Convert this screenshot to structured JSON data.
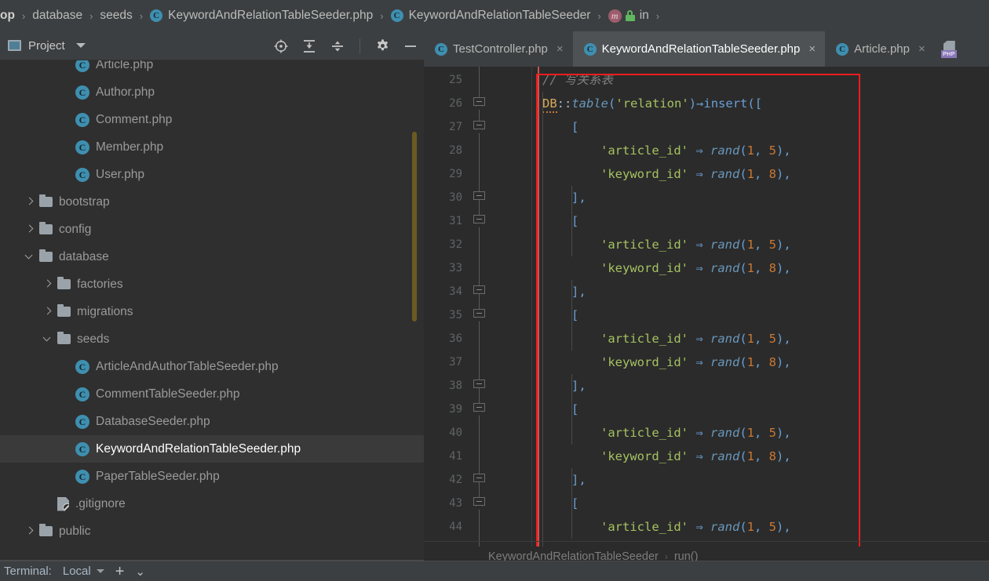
{
  "navbar": {
    "items": [
      {
        "label": "op",
        "icon": null,
        "bold": true
      },
      {
        "label": "database",
        "icon": null,
        "bold": false
      },
      {
        "label": "seeds",
        "icon": null,
        "bold": false
      },
      {
        "label": "KeywordAndRelationTableSeeder.php",
        "icon": "class-icon",
        "bold": false
      },
      {
        "label": "KeywordAndRelationTableSeeder",
        "icon": "class-icon",
        "bold": false
      },
      {
        "label": "in",
        "icon": "method-icon",
        "bold": false
      }
    ],
    "separator": "›"
  },
  "sidebar": {
    "title": "Project",
    "tools": [
      {
        "name": "locate-icon"
      },
      {
        "name": "expand-all-icon"
      },
      {
        "name": "collapse-all-icon"
      },
      {
        "name": "gear-icon"
      },
      {
        "name": "minimize-icon"
      }
    ],
    "tree": [
      {
        "label": "Article.php",
        "type": "file",
        "indent": 3,
        "expanded": null,
        "selected": false
      },
      {
        "label": "Author.php",
        "type": "file",
        "indent": 3,
        "expanded": null,
        "selected": false
      },
      {
        "label": "Comment.php",
        "type": "file",
        "indent": 3,
        "expanded": null,
        "selected": false
      },
      {
        "label": "Member.php",
        "type": "file",
        "indent": 3,
        "expanded": null,
        "selected": false
      },
      {
        "label": "User.php",
        "type": "file",
        "indent": 3,
        "expanded": null,
        "selected": false
      },
      {
        "label": "bootstrap",
        "type": "folder",
        "indent": 1,
        "expanded": false,
        "selected": false
      },
      {
        "label": "config",
        "type": "folder",
        "indent": 1,
        "expanded": false,
        "selected": false
      },
      {
        "label": "database",
        "type": "folder",
        "indent": 1,
        "expanded": true,
        "selected": false
      },
      {
        "label": "factories",
        "type": "folder",
        "indent": 2,
        "expanded": false,
        "selected": false
      },
      {
        "label": "migrations",
        "type": "folder",
        "indent": 2,
        "expanded": false,
        "selected": false
      },
      {
        "label": "seeds",
        "type": "folder",
        "indent": 2,
        "expanded": true,
        "selected": false
      },
      {
        "label": "ArticleAndAuthorTableSeeder.php",
        "type": "file",
        "indent": 3,
        "expanded": null,
        "selected": false
      },
      {
        "label": "CommentTableSeeder.php",
        "type": "file",
        "indent": 3,
        "expanded": null,
        "selected": false
      },
      {
        "label": "DatabaseSeeder.php",
        "type": "file",
        "indent": 3,
        "expanded": null,
        "selected": false
      },
      {
        "label": "KeywordAndRelationTableSeeder.php",
        "type": "file",
        "indent": 3,
        "expanded": null,
        "selected": true
      },
      {
        "label": "PaperTableSeeder.php",
        "type": "file",
        "indent": 3,
        "expanded": null,
        "selected": false
      },
      {
        "label": ".gitignore",
        "type": "gitignore",
        "indent": 2,
        "expanded": null,
        "selected": false
      },
      {
        "label": "public",
        "type": "folder",
        "indent": 1,
        "expanded": false,
        "selected": false
      }
    ]
  },
  "editor": {
    "tabs": [
      {
        "label": "TestController.php",
        "icon": "class-icon",
        "active": false,
        "close": "×"
      },
      {
        "label": "KeywordAndRelationTableSeeder.php",
        "icon": "class-icon",
        "active": true,
        "close": "×"
      },
      {
        "label": "Article.php",
        "icon": "class-icon",
        "active": false,
        "close": "×"
      }
    ],
    "extra_tab_icon": "php-file-icon",
    "line_numbers": [
      25,
      26,
      27,
      28,
      29,
      30,
      31,
      32,
      33,
      34,
      35,
      36,
      37,
      38,
      39,
      40,
      41,
      42,
      43,
      44
    ],
    "lines": [
      {
        "n": 25,
        "indent": 0,
        "tokens": [
          {
            "t": "// 写关系表",
            "c": "tk-cmt"
          }
        ]
      },
      {
        "n": 26,
        "indent": 0,
        "tokens": [
          {
            "t": "DB",
            "c": "tk-cls squiggle"
          },
          {
            "t": "::",
            "c": "tk-op"
          },
          {
            "t": "table",
            "c": "tk-fn"
          },
          {
            "t": "(",
            "c": "tk-brk"
          },
          {
            "t": "'relation'",
            "c": "tk-str"
          },
          {
            "t": ")",
            "c": "tk-brk"
          },
          {
            "t": "→",
            "c": "tk-brk"
          },
          {
            "t": "insert",
            "c": "tk-fn2"
          },
          {
            "t": "([",
            "c": "tk-brk"
          }
        ]
      },
      {
        "n": 27,
        "indent": 1,
        "tokens": [
          {
            "t": "[",
            "c": "tk-brk"
          }
        ]
      },
      {
        "n": 28,
        "indent": 2,
        "tokens": [
          {
            "t": "'article_id'",
            "c": "tk-str"
          },
          {
            "t": " ⇒ ",
            "c": "tk-brk"
          },
          {
            "t": "rand",
            "c": "tk-fn"
          },
          {
            "t": "(",
            "c": "tk-brk"
          },
          {
            "t": "1",
            "c": "tk-num"
          },
          {
            "t": ", ",
            "c": "tk-brk"
          },
          {
            "t": "5",
            "c": "tk-num"
          },
          {
            "t": "),",
            "c": "tk-brk"
          }
        ]
      },
      {
        "n": 29,
        "indent": 2,
        "tokens": [
          {
            "t": "'keyword_id'",
            "c": "tk-str"
          },
          {
            "t": " ⇒ ",
            "c": "tk-brk"
          },
          {
            "t": "rand",
            "c": "tk-fn"
          },
          {
            "t": "(",
            "c": "tk-brk"
          },
          {
            "t": "1",
            "c": "tk-num"
          },
          {
            "t": ", ",
            "c": "tk-brk"
          },
          {
            "t": "8",
            "c": "tk-num"
          },
          {
            "t": "),",
            "c": "tk-brk"
          }
        ]
      },
      {
        "n": 30,
        "indent": 1,
        "tokens": [
          {
            "t": "],",
            "c": "tk-brk"
          }
        ]
      },
      {
        "n": 31,
        "indent": 1,
        "tokens": [
          {
            "t": "[",
            "c": "tk-brk"
          }
        ]
      },
      {
        "n": 32,
        "indent": 2,
        "tokens": [
          {
            "t": "'article_id'",
            "c": "tk-str"
          },
          {
            "t": " ⇒ ",
            "c": "tk-brk"
          },
          {
            "t": "rand",
            "c": "tk-fn"
          },
          {
            "t": "(",
            "c": "tk-brk"
          },
          {
            "t": "1",
            "c": "tk-num"
          },
          {
            "t": ", ",
            "c": "tk-brk"
          },
          {
            "t": "5",
            "c": "tk-num"
          },
          {
            "t": "),",
            "c": "tk-brk"
          }
        ]
      },
      {
        "n": 33,
        "indent": 2,
        "tokens": [
          {
            "t": "'keyword_id'",
            "c": "tk-str"
          },
          {
            "t": " ⇒ ",
            "c": "tk-brk"
          },
          {
            "t": "rand",
            "c": "tk-fn"
          },
          {
            "t": "(",
            "c": "tk-brk"
          },
          {
            "t": "1",
            "c": "tk-num"
          },
          {
            "t": ", ",
            "c": "tk-brk"
          },
          {
            "t": "8",
            "c": "tk-num"
          },
          {
            "t": "),",
            "c": "tk-brk"
          }
        ]
      },
      {
        "n": 34,
        "indent": 1,
        "tokens": [
          {
            "t": "],",
            "c": "tk-brk"
          }
        ]
      },
      {
        "n": 35,
        "indent": 1,
        "tokens": [
          {
            "t": "[",
            "c": "tk-brk"
          }
        ]
      },
      {
        "n": 36,
        "indent": 2,
        "tokens": [
          {
            "t": "'article_id'",
            "c": "tk-str"
          },
          {
            "t": " ⇒ ",
            "c": "tk-brk"
          },
          {
            "t": "rand",
            "c": "tk-fn"
          },
          {
            "t": "(",
            "c": "tk-brk"
          },
          {
            "t": "1",
            "c": "tk-num"
          },
          {
            "t": ", ",
            "c": "tk-brk"
          },
          {
            "t": "5",
            "c": "tk-num"
          },
          {
            "t": "),",
            "c": "tk-brk"
          }
        ]
      },
      {
        "n": 37,
        "indent": 2,
        "tokens": [
          {
            "t": "'keyword_id'",
            "c": "tk-str"
          },
          {
            "t": " ⇒ ",
            "c": "tk-brk"
          },
          {
            "t": "rand",
            "c": "tk-fn"
          },
          {
            "t": "(",
            "c": "tk-brk"
          },
          {
            "t": "1",
            "c": "tk-num"
          },
          {
            "t": ", ",
            "c": "tk-brk"
          },
          {
            "t": "8",
            "c": "tk-num"
          },
          {
            "t": "),",
            "c": "tk-brk"
          }
        ]
      },
      {
        "n": 38,
        "indent": 1,
        "tokens": [
          {
            "t": "],",
            "c": "tk-brk"
          }
        ]
      },
      {
        "n": 39,
        "indent": 1,
        "tokens": [
          {
            "t": "[",
            "c": "tk-brk"
          }
        ]
      },
      {
        "n": 40,
        "indent": 2,
        "tokens": [
          {
            "t": "'article_id'",
            "c": "tk-str"
          },
          {
            "t": " ⇒ ",
            "c": "tk-brk"
          },
          {
            "t": "rand",
            "c": "tk-fn"
          },
          {
            "t": "(",
            "c": "tk-brk"
          },
          {
            "t": "1",
            "c": "tk-num"
          },
          {
            "t": ", ",
            "c": "tk-brk"
          },
          {
            "t": "5",
            "c": "tk-num"
          },
          {
            "t": "),",
            "c": "tk-brk"
          }
        ]
      },
      {
        "n": 41,
        "indent": 2,
        "tokens": [
          {
            "t": "'keyword_id'",
            "c": "tk-str"
          },
          {
            "t": " ⇒ ",
            "c": "tk-brk"
          },
          {
            "t": "rand",
            "c": "tk-fn"
          },
          {
            "t": "(",
            "c": "tk-brk"
          },
          {
            "t": "1",
            "c": "tk-num"
          },
          {
            "t": ", ",
            "c": "tk-brk"
          },
          {
            "t": "8",
            "c": "tk-num"
          },
          {
            "t": "),",
            "c": "tk-brk"
          }
        ]
      },
      {
        "n": 42,
        "indent": 1,
        "tokens": [
          {
            "t": "],",
            "c": "tk-brk"
          }
        ]
      },
      {
        "n": 43,
        "indent": 1,
        "tokens": [
          {
            "t": "[",
            "c": "tk-brk"
          }
        ]
      },
      {
        "n": 44,
        "indent": 2,
        "tokens": [
          {
            "t": "'article_id'",
            "c": "tk-str"
          },
          {
            "t": " ⇒ ",
            "c": "tk-brk"
          },
          {
            "t": "rand",
            "c": "tk-fn"
          },
          {
            "t": "(",
            "c": "tk-brk"
          },
          {
            "t": "1",
            "c": "tk-num"
          },
          {
            "t": ", ",
            "c": "tk-brk"
          },
          {
            "t": "5",
            "c": "tk-num"
          },
          {
            "t": "),",
            "c": "tk-brk"
          }
        ]
      }
    ],
    "folds": [
      {
        "line": 26,
        "type": "down"
      },
      {
        "line": 27,
        "type": "down"
      },
      {
        "line": 30,
        "type": "up"
      },
      {
        "line": 31,
        "type": "down"
      },
      {
        "line": 34,
        "type": "up"
      },
      {
        "line": 35,
        "type": "down"
      },
      {
        "line": 38,
        "type": "up"
      },
      {
        "line": 39,
        "type": "down"
      },
      {
        "line": 42,
        "type": "up"
      },
      {
        "line": 43,
        "type": "down"
      }
    ],
    "breadcrumb": {
      "class": "KeywordAndRelationTableSeeder",
      "method": "run()",
      "separator": "›"
    },
    "annotation_color": "#ee1c1c"
  },
  "bottombar": {
    "label": "Terminal:",
    "session": "Local",
    "add": "+",
    "collapse": "⌄"
  },
  "colors": {
    "background": "#2b2b2b",
    "panel": "#3c3f41",
    "tree_bg": "#2f2f2f",
    "selection": "#3a3a3a",
    "accent": "#3e8fb0",
    "string": "#a5c261",
    "number": "#cc7832",
    "comment": "#808080",
    "annotation": "#ee1c1c",
    "scrollbar": "#6b5a21"
  }
}
